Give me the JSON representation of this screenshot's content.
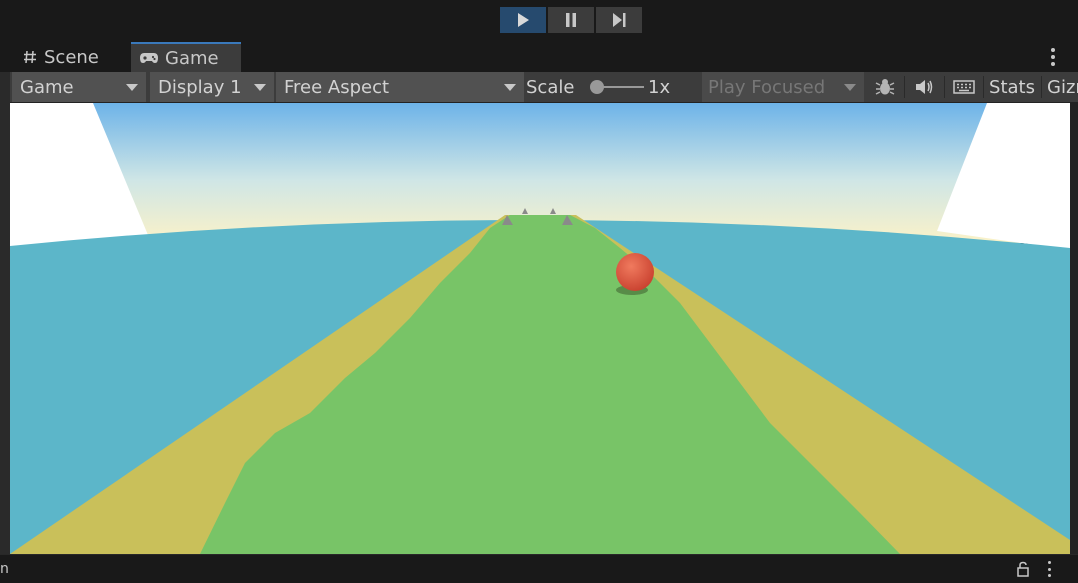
{
  "playbar": {
    "play_icon": "play-icon",
    "pause_icon": "pause-icon",
    "step_icon": "step-icon",
    "play_active": true
  },
  "tabs": [
    {
      "label": "Scene",
      "icon": "hash-icon"
    },
    {
      "label": "Game",
      "icon": "gamepad-icon",
      "active": true
    }
  ],
  "toolbar": {
    "view_mode": "Game",
    "display": "Display 1",
    "aspect": "Free Aspect",
    "scale_label": "Scale",
    "scale_value": "1x",
    "scale_slider_level": 0.0,
    "play_mode": "Play Focused",
    "bug_icon": "bug-icon",
    "audio_icon": "speaker-icon",
    "keyboard_icon": "keyboard-icon",
    "stats": "Stats",
    "gizmos": "Gizmos"
  },
  "scene": {
    "sky_top": "#6db3e8",
    "sky_horizon": "#fbf2c8",
    "water": "#5cb6c9",
    "sand": "#c9c05a",
    "grass": "#78c467",
    "ball": "#e25a42"
  },
  "statusbar": {
    "left_text": "n",
    "lock_icon": "lock-icon",
    "menu_icon": "kebab-menu-icon"
  },
  "colors": {
    "accent": "#3a79bb",
    "play_active_bg": "#264a6e",
    "panel": "#3c3c3c",
    "background": "#191919"
  }
}
